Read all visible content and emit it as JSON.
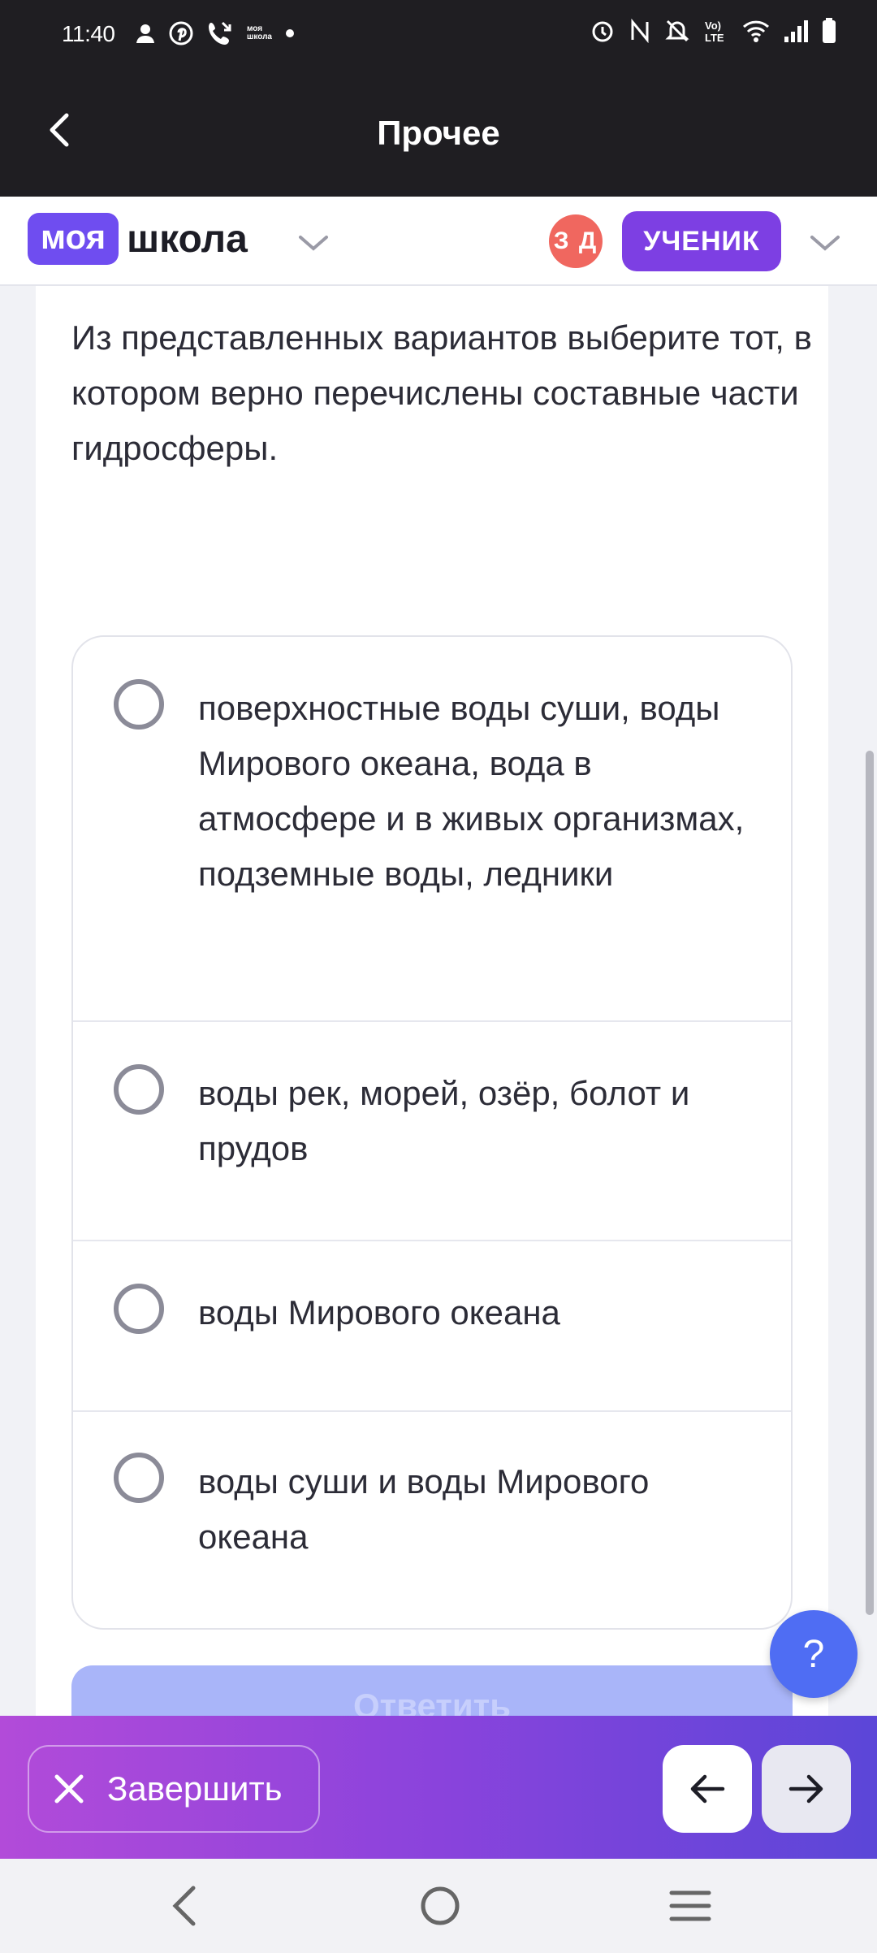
{
  "status_bar": {
    "time": "11:40",
    "mini_logo_line1": "моя",
    "mini_logo_line2": "школа",
    "icons_left": [
      "person-icon",
      "pinterest-icon",
      "missed-call-icon",
      "moya-shkola-icon",
      "dot-icon"
    ],
    "icons_right": [
      "alarm-icon",
      "nfc-icon",
      "mute-icon",
      "volte-icon",
      "wifi-icon",
      "signal-icon",
      "battery-icon"
    ]
  },
  "app_bar": {
    "title": "Прочее",
    "back_icon": "chevron-left-icon"
  },
  "header": {
    "logo_part1": "моя",
    "logo_part2": "школа",
    "avatar_initials": "З Д",
    "role_label": "УЧЕНИК",
    "avatar_color": "#f0675f",
    "role_color": "#7d3fe3"
  },
  "question": {
    "text": "Из представленных вариантов выберите тот, в котором верно перечислены составные части гидросферы."
  },
  "options": [
    {
      "text": "поверхностные воды суши, воды Мирового океана, вода в атмосфере и в живых организмах, подземные воды, ледники",
      "selected": false
    },
    {
      "text": "воды рек, морей, озёр, болот и прудов",
      "selected": false
    },
    {
      "text": "воды Мирового океана",
      "selected": false
    },
    {
      "text": "воды суши и воды Мирового океана",
      "selected": false
    }
  ],
  "answer_button": {
    "label": "Ответить",
    "enabled": false
  },
  "help_button": {
    "label": "?"
  },
  "action_bar": {
    "finish_label": "Завершить",
    "prev_icon": "arrow-left-icon",
    "next_icon": "arrow-right-icon"
  },
  "colors": {
    "accent": "#6f4df0",
    "help": "#4f6df3",
    "dark_bar": "#1f1e22"
  }
}
